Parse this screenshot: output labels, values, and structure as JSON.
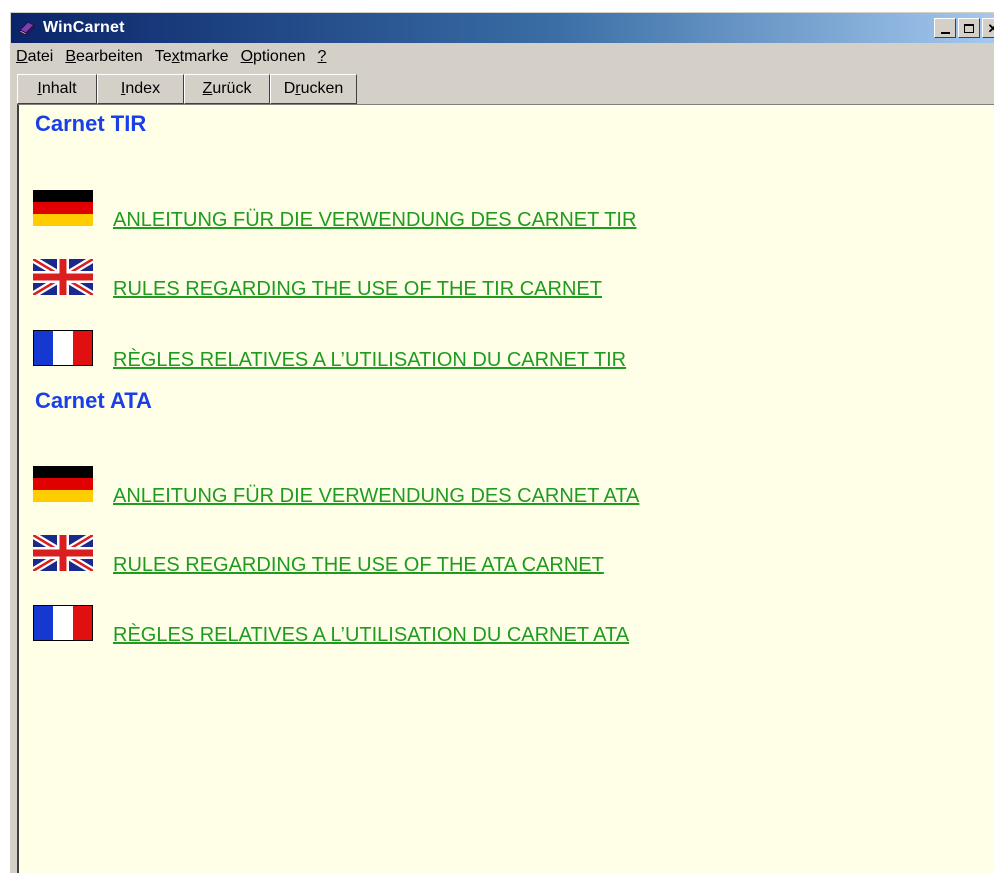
{
  "window": {
    "title": "WinCarnet"
  },
  "menu": {
    "items": [
      {
        "label": "Datei",
        "mnemonic": "D",
        "rest": "atei"
      },
      {
        "label": "Bearbeiten",
        "mnemonic": "B",
        "rest": "earbeiten"
      },
      {
        "label": "Textmarke",
        "pre": "Te",
        "mnemonic": "x",
        "rest": "tmarke"
      },
      {
        "label": "Optionen",
        "mnemonic": "O",
        "rest": "ptionen"
      },
      {
        "label": "?",
        "mnemonic": "?",
        "rest": ""
      }
    ]
  },
  "toolbar": {
    "buttons": [
      {
        "label": "Inhalt",
        "mnemonic": "I",
        "rest": "nhalt"
      },
      {
        "label": "Index",
        "mnemonic": "I",
        "rest": "ndex"
      },
      {
        "label": "Zurück",
        "mnemonic": "Z",
        "rest": "urück"
      },
      {
        "label": "Drucken",
        "pre": "D",
        "mnemonic": "r",
        "rest": "ucken"
      }
    ]
  },
  "content": {
    "sections": [
      {
        "title": "Carnet TIR",
        "entries": [
          {
            "flag": "germany-flag-icon",
            "label": "ANLEITUNG FÜR DIE VERWENDUNG DES CARNET TIR"
          },
          {
            "flag": "uk-flag-icon",
            "label": "RULES REGARDING THE USE OF THE TIR CARNET"
          },
          {
            "flag": "france-flag-icon",
            "label": "RÈGLES RELATIVES A L’UTILISATION DU CARNET TIR"
          }
        ]
      },
      {
        "title": "Carnet ATA",
        "entries": [
          {
            "flag": "germany-flag-icon",
            "label": "ANLEITUNG FÜR DIE VERWENDUNG DES CARNET ATA"
          },
          {
            "flag": "uk-flag-icon",
            "label": "RULES REGARDING THE USE OF THE ATA CARNET"
          },
          {
            "flag": "france-flag-icon",
            "label": "RÈGLES RELATIVES A L’UTILISATION DU CARNET ATA"
          }
        ]
      }
    ]
  },
  "colors": {
    "section_title": "#1a3fe6",
    "link": "#1f9b1f",
    "content_background": "#ffffe8",
    "titlebar_start": "#0a246a"
  }
}
